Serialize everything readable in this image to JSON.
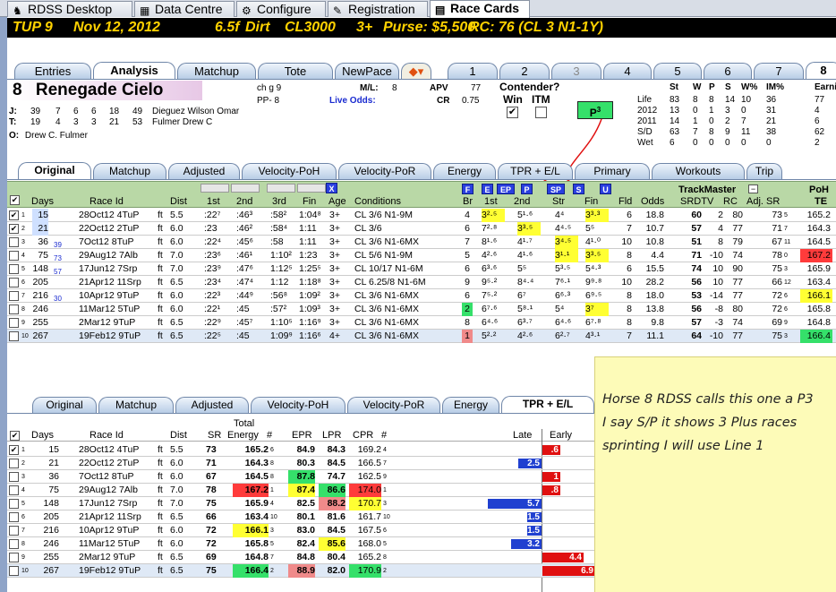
{
  "top_tabs": [
    {
      "label": "RDSS Desktop",
      "icon": "horse-icon"
    },
    {
      "label": "Data Centre",
      "icon": "table-icon"
    },
    {
      "label": "Configure",
      "icon": "gear-icon"
    },
    {
      "label": "Registration",
      "icon": "pencil-icon"
    },
    {
      "label": "Race Cards",
      "icon": "card-icon",
      "active": true
    }
  ],
  "race": {
    "track": "TUP 9",
    "date": "Nov 12, 2012",
    "distance": "6.5f",
    "surface": "Dirt",
    "class": "CL3000",
    "age": "3+",
    "purse": "Purse: $5,500",
    "rc": "RC: 76 (CL 3 N1-1Y)"
  },
  "view_tabs": [
    "Entries",
    "Analysis",
    "Matchup",
    "Tote",
    "NewPace"
  ],
  "horse_tabs": [
    "1",
    "2",
    "3",
    "4",
    "5",
    "6",
    "7",
    "8"
  ],
  "horse": {
    "number": "8",
    "name": "Renegade Cielo",
    "desc": "ch g 9",
    "pp": "PP- 8",
    "ml_label": "M/L:",
    "ml": "8",
    "live_odds_label": "Live Odds:",
    "apv_label": "APV",
    "apv": "77",
    "cr_label": "CR",
    "cr": "0.75",
    "contender_label": "Contender?",
    "win_label": "Win",
    "itm_label": "ITM",
    "pace_badge": "P",
    "pace_badge_sup": "3",
    "jockey": {
      "label": "J:",
      "stats": [
        "39",
        "7",
        "6",
        "6",
        "18",
        "49"
      ],
      "name": "Dieguez Wilson Omar"
    },
    "trainer": {
      "label": "T:",
      "stats": [
        "19",
        "4",
        "3",
        "3",
        "21",
        "53"
      ],
      "name": "Fulmer Drew C"
    },
    "owner": {
      "label": "O:",
      "name": "Drew C. Fulmer"
    }
  },
  "record": {
    "headers": [
      "St",
      "W",
      "P",
      "S",
      "W%",
      "IM%",
      "Earni"
    ],
    "rows": [
      {
        "label": "Life",
        "vals": [
          "83",
          "8",
          "8",
          "14",
          "10",
          "36",
          "77"
        ]
      },
      {
        "label": "2012",
        "vals": [
          "13",
          "0",
          "1",
          "3",
          "0",
          "31",
          "4"
        ]
      },
      {
        "label": "2011",
        "vals": [
          "14",
          "1",
          "0",
          "2",
          "7",
          "21",
          "6"
        ]
      },
      {
        "label": "S/D",
        "vals": [
          "63",
          "7",
          "8",
          "9",
          "11",
          "38",
          "62"
        ]
      },
      {
        "label": "Wet",
        "vals": [
          "6",
          "0",
          "0",
          "0",
          "0",
          "0",
          "2"
        ]
      }
    ]
  },
  "sub_tabs": [
    "Original",
    "Matchup",
    "Adjusted",
    "Velocity-PoH",
    "Velocity-PoR",
    "Energy",
    "TPR + E/L",
    "Primary",
    "Workouts",
    "Trip"
  ],
  "pp_headers": {
    "days": "Days",
    "race_id": "Race Id",
    "dist": "Dist",
    "c1": "1st",
    "c2": "2nd",
    "c3": "3rd",
    "fin": "Fin",
    "age": "Age",
    "conditions": "Conditions",
    "br": "Br",
    "first": "1st",
    "second": "2nd",
    "str": "Str",
    "fin2": "Fin",
    "fld": "Fld",
    "odds": "Odds",
    "trackmaster": "TrackMaster",
    "srdtv": "SRDTV",
    "rc": "RC",
    "adjsr": "Adj. SR",
    "poh": "PoH",
    "te": "TE",
    "buttons": [
      "F",
      "E",
      "EP",
      "P",
      "SP",
      "S",
      "U"
    ]
  },
  "pp_rows": [
    {
      "n": "1",
      "days": "15",
      "rid": "28Oct12 4TuP",
      "ft": "ft",
      "dist": "5.5",
      "c1": ":22⁷",
      "c2": ":46³",
      "c3": ":58²",
      "fin": "1:04⁸",
      "age": "3+",
      "cond": "CL 3/6 N1-9M",
      "br": "4",
      "p1": "3²·⁵",
      "p2": "5¹·⁶",
      "str": "4⁴",
      "f": "3³·³",
      "fld": "6",
      "odds": "18.8",
      "sr": "60",
      "dtv": "2",
      "rc": "80",
      "adj": "73",
      "adjs": "5",
      "te": "165.2"
    },
    {
      "n": "2",
      "days": "21",
      "rid": "22Oct12 2TuP",
      "ft": "ft",
      "dist": "6.0",
      "c1": ":23",
      "c2": ":46²",
      "c3": ":58⁴",
      "fin": "1:11",
      "age": "3+",
      "cond": "CL 3/6",
      "br": "6",
      "p1": "7²·⁸",
      "p2": "3³·⁵",
      "str": "4⁴·⁵",
      "f": "5⁵",
      "fld": "7",
      "odds": "10.7",
      "sr": "57",
      "dtv": "4",
      "rc": "77",
      "adj": "71",
      "adjs": "7",
      "te": "164.3"
    },
    {
      "n": "3",
      "days": "36",
      "sub": "39",
      "rid": "7Oct12 8TuP",
      "ft": "ft",
      "dist": "6.0",
      "c1": ":22⁴",
      "c2": ":45⁶",
      "c3": ":58",
      "fin": "1:11",
      "age": "3+",
      "cond": "CL 3/6 N1-6MX",
      "br": "7",
      "p1": "8¹·⁶",
      "p2": "4¹·⁷",
      "str": "3⁴·⁵",
      "f": "4¹·⁰",
      "fld": "10",
      "odds": "10.8",
      "sr": "51",
      "dtv": "8",
      "rc": "79",
      "adj": "67",
      "adjs": "11",
      "te": "164.5"
    },
    {
      "n": "4",
      "days": "75",
      "sub": "73",
      "rid": "29Aug12 7Alb",
      "ft": "ft",
      "dist": "7.0",
      "c1": ":23⁶",
      "c2": ":46¹",
      "c3": "1:10²",
      "fin": "1:23",
      "age": "3+",
      "cond": "CL 5/6 N1-9M",
      "br": "5",
      "p1": "4²·⁶",
      "p2": "4¹·⁶",
      "str": "3¹·¹",
      "f": "3³·⁵",
      "fld": "8",
      "odds": "4.4",
      "sr": "71",
      "dtv": "-10",
      "rc": "74",
      "adj": "78",
      "adjs": "0",
      "te": "167.2"
    },
    {
      "n": "5",
      "days": "148",
      "sub": "57",
      "rid": "17Jun12 7Srp",
      "ft": "ft",
      "dist": "7.0",
      "c1": ":23⁹",
      "c2": ":47⁶",
      "c3": "1:12⁵",
      "fin": "1:25⁵",
      "age": "3+",
      "cond": "CL 10/17 N1-6M",
      "br": "6",
      "p1": "6³·⁶",
      "p2": "5⁵",
      "str": "5³·⁵",
      "f": "5⁴·³",
      "fld": "6",
      "odds": "15.5",
      "sr": "74",
      "dtv": "10",
      "rc": "90",
      "adj": "75",
      "adjs": "3",
      "te": "165.9"
    },
    {
      "n": "6",
      "days": "205",
      "rid": "21Apr12 11Srp",
      "ft": "ft",
      "dist": "6.5",
      "c1": ":23⁴",
      "c2": ":47⁴",
      "c3": "1:12",
      "fin": "1:18⁸",
      "age": "3+",
      "cond": "CL 6.25/8 N1-6M",
      "br": "9",
      "p1": "9⁵·²",
      "p2": "8⁴·⁴",
      "str": "7⁶·¹",
      "f": "9⁹·⁸",
      "fld": "10",
      "odds": "28.2",
      "sr": "56",
      "dtv": "10",
      "rc": "77",
      "adj": "66",
      "adjs": "12",
      "te": "163.4"
    },
    {
      "n": "7",
      "days": "216",
      "sub": "30",
      "rid": "10Apr12 9TuP",
      "ft": "ft",
      "dist": "6.0",
      "c1": ":22³",
      "c2": ":44⁹",
      "c3": ":56⁸",
      "fin": "1:09²",
      "age": "3+",
      "cond": "CL 3/6 N1-6MX",
      "br": "6",
      "p1": "7⁵·²",
      "p2": "6⁷",
      "str": "6⁶·³",
      "f": "6⁹·⁵",
      "fld": "8",
      "odds": "18.0",
      "sr": "53",
      "dtv": "-14",
      "rc": "77",
      "adj": "72",
      "adjs": "6",
      "te": "166.1"
    },
    {
      "n": "8",
      "days": "246",
      "rid": "11Mar12 5TuP",
      "ft": "ft",
      "dist": "6.0",
      "c1": ":22¹",
      "c2": ":45",
      "c3": ":57²",
      "fin": "1:09³",
      "age": "3+",
      "cond": "CL 3/6 N1-6MX",
      "br": "2",
      "p1": "6⁷·⁶",
      "p2": "5⁸·¹",
      "str": "5⁴",
      "f": "3⁷",
      "fld": "8",
      "odds": "13.8",
      "sr": "56",
      "dtv": "-8",
      "rc": "80",
      "adj": "72",
      "adjs": "6",
      "te": "165.8"
    },
    {
      "n": "9",
      "days": "255",
      "rid": "2Mar12 9TuP",
      "ft": "ft",
      "dist": "6.5",
      "c1": ":22⁹",
      "c2": ":45⁷",
      "c3": "1:10⁵",
      "fin": "1:16⁹",
      "age": "3+",
      "cond": "CL 3/6 N1-6MX",
      "br": "8",
      "p1": "6⁴·⁶",
      "p2": "6³·⁷",
      "str": "6⁴·⁶",
      "f": "6⁷·⁸",
      "fld": "8",
      "odds": "9.8",
      "sr": "57",
      "dtv": "-3",
      "rc": "74",
      "adj": "69",
      "adjs": "9",
      "te": "164.8"
    },
    {
      "n": "10",
      "days": "267",
      "rid": "19Feb12 9TuP",
      "ft": "ft",
      "dist": "6.5",
      "c1": ":22⁵",
      "c2": ":45",
      "c3": "1:09⁹",
      "fin": "1:16⁶",
      "age": "4+",
      "cond": "CL 3/6 N1-6MX",
      "br": "1",
      "p1": "5²·²",
      "p2": "4²·⁶",
      "str": "6²·⁷",
      "f": "4³·¹",
      "fld": "7",
      "odds": "11.1",
      "sr": "64",
      "dtv": "-10",
      "rc": "77",
      "adj": "75",
      "adjs": "3",
      "te": "166.4"
    }
  ],
  "tpr_headers": {
    "days": "Days",
    "race_id": "Race Id",
    "dist": "Dist",
    "sr": "SR",
    "total": "Total",
    "energy": "Energy",
    "hash": "#",
    "epr": "EPR",
    "lpr": "LPR",
    "cpr": "CPR",
    "late": "Late",
    "early": "Early"
  },
  "tpr_rows": [
    {
      "n": "1",
      "days": "15",
      "rid": "28Oct12 4TuP",
      "dist": "5.5",
      "sr": "73",
      "te": "165.2",
      "ter": "6",
      "epr": "84.9",
      "lpr": "84.3",
      "cpr": "169.2",
      "cr": "4",
      "late": null,
      "early": ".6"
    },
    {
      "n": "2",
      "days": "21",
      "rid": "22Oct12 2TuP",
      "dist": "6.0",
      "sr": "71",
      "te": "164.3",
      "ter": "8",
      "epr": "80.3",
      "lpr": "84.5",
      "cpr": "166.5",
      "cr": "7",
      "late": "2.5",
      "early": null
    },
    {
      "n": "3",
      "days": "36",
      "rid": "7Oct12 8TuP",
      "dist": "6.0",
      "sr": "67",
      "te": "164.5",
      "ter": "8",
      "epr": "87.8",
      "lpr": "74.7",
      "cpr": "162.5",
      "cr": "9",
      "late": null,
      "early": "1"
    },
    {
      "n": "4",
      "days": "75",
      "rid": "29Aug12 7Alb",
      "dist": "7.0",
      "sr": "78",
      "te": "167.2",
      "ter": "1",
      "epr": "87.4",
      "lpr": "86.6",
      "cpr": "174.0",
      "cr": "1",
      "late": null,
      "early": ".8"
    },
    {
      "n": "5",
      "days": "148",
      "rid": "17Jun12 7Srp",
      "dist": "7.0",
      "sr": "75",
      "te": "165.9",
      "ter": "4",
      "epr": "82.5",
      "lpr": "88.2",
      "cpr": "170.7",
      "cr": "3",
      "late": "5.7",
      "early": null
    },
    {
      "n": "6",
      "days": "205",
      "rid": "21Apr12 11Srp",
      "dist": "6.5",
      "sr": "66",
      "te": "163.4",
      "ter": "10",
      "epr": "80.1",
      "lpr": "81.6",
      "cpr": "161.7",
      "cr": "10",
      "late": "1.5",
      "early": null
    },
    {
      "n": "7",
      "days": "216",
      "rid": "10Apr12 9TuP",
      "dist": "6.0",
      "sr": "72",
      "te": "166.1",
      "ter": "3",
      "epr": "83.0",
      "lpr": "84.5",
      "cpr": "167.5",
      "cr": "6",
      "late": "1.5",
      "early": null
    },
    {
      "n": "8",
      "days": "246",
      "rid": "11Mar12 5TuP",
      "dist": "6.0",
      "sr": "72",
      "te": "165.8",
      "ter": "5",
      "epr": "82.4",
      "lpr": "85.6",
      "cpr": "168.0",
      "cr": "5",
      "late": "3.2",
      "early": null
    },
    {
      "n": "9",
      "days": "255",
      "rid": "2Mar12 9TuP",
      "dist": "6.5",
      "sr": "69",
      "te": "164.8",
      "ter": "7",
      "epr": "84.8",
      "lpr": "80.4",
      "cpr": "165.2",
      "cr": "8",
      "late": null,
      "early": "4.4"
    },
    {
      "n": "10",
      "days": "267",
      "rid": "19Feb12 9TuP",
      "dist": "6.5",
      "sr": "75",
      "te": "166.4",
      "ter": "2",
      "epr": "88.9",
      "lpr": "82.0",
      "cpr": "170.9",
      "cr": "2",
      "late": null,
      "early": "6.9"
    }
  ],
  "note": {
    "lines": [
      "Horse 8 RDSS calls this one a P3",
      "I say S/P  it shows 3 Plus races",
      "sprinting  I will use  Line 1"
    ]
  },
  "colors": {
    "highlight_yellow": "#ffff33",
    "highlight_green": "#35e06a",
    "highlight_red": "#ff3b3b",
    "late_bar": "#2040d0",
    "early_bar": "#e01010",
    "header_green": "#b9d8a6"
  }
}
